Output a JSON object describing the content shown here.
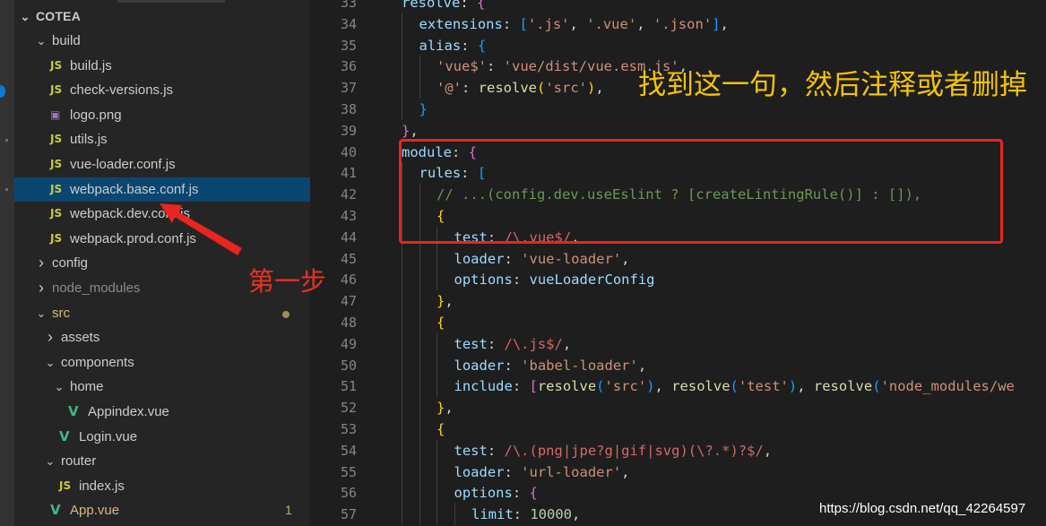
{
  "explorer": {
    "root": "COTEA",
    "items": [
      {
        "label": "build",
        "kind": "folder-open",
        "depth": 1
      },
      {
        "label": "build.js",
        "kind": "js",
        "depth": 2
      },
      {
        "label": "check-versions.js",
        "kind": "js",
        "depth": 2
      },
      {
        "label": "logo.png",
        "kind": "image",
        "depth": 2
      },
      {
        "label": "utils.js",
        "kind": "js",
        "depth": 2
      },
      {
        "label": "vue-loader.conf.js",
        "kind": "js",
        "depth": 2
      },
      {
        "label": "webpack.base.conf.js",
        "kind": "js",
        "depth": 2,
        "selected": true
      },
      {
        "label": "webpack.dev.conf.js",
        "kind": "js",
        "depth": 2
      },
      {
        "label": "webpack.prod.conf.js",
        "kind": "js",
        "depth": 2
      },
      {
        "label": "config",
        "kind": "folder-closed",
        "depth": 1
      },
      {
        "label": "node_modules",
        "kind": "folder-closed",
        "depth": 1,
        "dim": true
      },
      {
        "label": "src",
        "kind": "folder-open",
        "depth": 1,
        "modified": true,
        "badge": "dot"
      },
      {
        "label": "assets",
        "kind": "folder-closed",
        "depth": 2
      },
      {
        "label": "components",
        "kind": "folder-open",
        "depth": 2
      },
      {
        "label": "home",
        "kind": "folder-open",
        "depth": 3
      },
      {
        "label": "Appindex.vue",
        "kind": "vue",
        "depth": 4
      },
      {
        "label": "Login.vue",
        "kind": "vue",
        "depth": 3
      },
      {
        "label": "router",
        "kind": "folder-open",
        "depth": 2
      },
      {
        "label": "index.js",
        "kind": "js",
        "depth": 3
      },
      {
        "label": "App.vue",
        "kind": "vue",
        "depth": 2,
        "modified": true,
        "badge": "1"
      }
    ]
  },
  "editor": {
    "lines": [
      {
        "n": "33",
        "indent": 0,
        "tokens": [
          [
            "k",
            "resolve"
          ],
          [
            "p",
            ": "
          ],
          [
            "b2",
            "{"
          ]
        ]
      },
      {
        "n": "34",
        "indent": 1,
        "tokens": [
          [
            "k",
            "extensions"
          ],
          [
            "p",
            ": "
          ],
          [
            "b3",
            "["
          ],
          [
            "s",
            "'.js'"
          ],
          [
            "p",
            ", "
          ],
          [
            "s",
            "'.vue'"
          ],
          [
            "p",
            ", "
          ],
          [
            "s",
            "'.json'"
          ],
          [
            "b3",
            "]"
          ],
          [
            "p",
            ","
          ]
        ]
      },
      {
        "n": "35",
        "indent": 1,
        "tokens": [
          [
            "k",
            "alias"
          ],
          [
            "p",
            ": "
          ],
          [
            "b3",
            "{"
          ]
        ]
      },
      {
        "n": "36",
        "indent": 2,
        "tokens": [
          [
            "s",
            "'vue$'"
          ],
          [
            "p",
            ": "
          ],
          [
            "s",
            "'vue/dist/vue.esm.js'"
          ],
          [
            "p",
            ","
          ]
        ]
      },
      {
        "n": "37",
        "indent": 2,
        "tokens": [
          [
            "s",
            "'@'"
          ],
          [
            "p",
            ": "
          ],
          [
            "f",
            "resolve"
          ],
          [
            "b1",
            "("
          ],
          [
            "s",
            "'src'"
          ],
          [
            "b1",
            ")"
          ],
          [
            "p",
            ","
          ]
        ]
      },
      {
        "n": "38",
        "indent": 1,
        "tokens": [
          [
            "b3",
            "}"
          ]
        ]
      },
      {
        "n": "39",
        "indent": 0,
        "tokens": [
          [
            "b2",
            "}"
          ],
          [
            "p",
            ","
          ]
        ]
      },
      {
        "n": "40",
        "indent": 0,
        "tokens": [
          [
            "k",
            "module"
          ],
          [
            "p",
            ": "
          ],
          [
            "b2",
            "{"
          ]
        ]
      },
      {
        "n": "41",
        "indent": 1,
        "tokens": [
          [
            "k",
            "rules"
          ],
          [
            "p",
            ": "
          ],
          [
            "b3",
            "["
          ]
        ]
      },
      {
        "n": "42",
        "indent": 2,
        "tokens": [
          [
            "c",
            "// ...(config.dev.useEslint ? [createLintingRule()] : []),"
          ]
        ]
      },
      {
        "n": "43",
        "indent": 2,
        "tokens": [
          [
            "b1",
            "{"
          ]
        ]
      },
      {
        "n": "44",
        "indent": 3,
        "tokens": [
          [
            "k",
            "test"
          ],
          [
            "p",
            ": "
          ],
          [
            "r",
            "/\\.vue$/"
          ],
          [
            "p",
            ","
          ]
        ]
      },
      {
        "n": "45",
        "indent": 3,
        "tokens": [
          [
            "k",
            "loader"
          ],
          [
            "p",
            ": "
          ],
          [
            "s",
            "'vue-loader'"
          ],
          [
            "p",
            ","
          ]
        ]
      },
      {
        "n": "46",
        "indent": 3,
        "tokens": [
          [
            "k",
            "options"
          ],
          [
            "p",
            ": "
          ],
          [
            "k",
            "vueLoaderConfig"
          ]
        ]
      },
      {
        "n": "47",
        "indent": 2,
        "tokens": [
          [
            "b1",
            "}"
          ],
          [
            "p",
            ","
          ]
        ]
      },
      {
        "n": "48",
        "indent": 2,
        "tokens": [
          [
            "b1",
            "{"
          ]
        ]
      },
      {
        "n": "49",
        "indent": 3,
        "tokens": [
          [
            "k",
            "test"
          ],
          [
            "p",
            ": "
          ],
          [
            "r",
            "/\\.js$/"
          ],
          [
            "p",
            ","
          ]
        ]
      },
      {
        "n": "50",
        "indent": 3,
        "tokens": [
          [
            "k",
            "loader"
          ],
          [
            "p",
            ": "
          ],
          [
            "s",
            "'babel-loader'"
          ],
          [
            "p",
            ","
          ]
        ]
      },
      {
        "n": "51",
        "indent": 3,
        "tokens": [
          [
            "k",
            "include"
          ],
          [
            "p",
            ": "
          ],
          [
            "b2",
            "["
          ],
          [
            "f",
            "resolve"
          ],
          [
            "b3",
            "("
          ],
          [
            "s",
            "'src'"
          ],
          [
            "b3",
            ")"
          ],
          [
            "p",
            ", "
          ],
          [
            "f",
            "resolve"
          ],
          [
            "b3",
            "("
          ],
          [
            "s",
            "'test'"
          ],
          [
            "b3",
            ")"
          ],
          [
            "p",
            ", "
          ],
          [
            "f",
            "resolve"
          ],
          [
            "b3",
            "("
          ],
          [
            "s",
            "'node_modules/we"
          ]
        ]
      },
      {
        "n": "52",
        "indent": 2,
        "tokens": [
          [
            "b1",
            "}"
          ],
          [
            "p",
            ","
          ]
        ]
      },
      {
        "n": "53",
        "indent": 2,
        "tokens": [
          [
            "b1",
            "{"
          ]
        ]
      },
      {
        "n": "54",
        "indent": 3,
        "tokens": [
          [
            "k",
            "test"
          ],
          [
            "p",
            ": "
          ],
          [
            "r",
            "/\\.(png|jpe?g|gif|svg)(\\?.*)?$/"
          ],
          [
            "p",
            ","
          ]
        ]
      },
      {
        "n": "55",
        "indent": 3,
        "tokens": [
          [
            "k",
            "loader"
          ],
          [
            "p",
            ": "
          ],
          [
            "s",
            "'url-loader'"
          ],
          [
            "p",
            ","
          ]
        ]
      },
      {
        "n": "56",
        "indent": 3,
        "tokens": [
          [
            "k",
            "options"
          ],
          [
            "p",
            ": "
          ],
          [
            "b2",
            "{"
          ]
        ]
      },
      {
        "n": "57",
        "indent": 4,
        "tokens": [
          [
            "k",
            "limit"
          ],
          [
            "p",
            ": "
          ],
          [
            "n",
            "10000"
          ],
          [
            "p",
            ","
          ]
        ]
      }
    ]
  },
  "annotations": {
    "instruction": "找到这一句，然后注释或者删掉",
    "step": "第一步",
    "watermark": "https://blog.csdn.net/qq_42264597",
    "box_color": "#e8251f",
    "instruction_color": "#f5c400",
    "step_color": "#e53326"
  }
}
